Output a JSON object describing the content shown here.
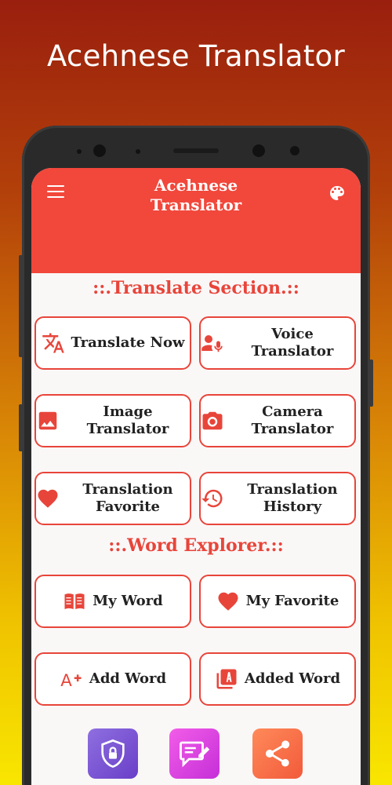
{
  "promo": {
    "title": "Acehnese Translator"
  },
  "appbar": {
    "title": "Acehnese\nTranslator"
  },
  "sections": {
    "translate": "::.Translate Section.::",
    "explorer": "::.Word Explorer.::"
  },
  "buttons": {
    "translate_now": "Translate Now",
    "voice_translator": "Voice Translator",
    "image_translator": "Image Translator",
    "camera_translator": "Camera Translator",
    "translation_favorite": "Translation Favorite",
    "translation_history": "Translation History",
    "my_word": "My Word",
    "my_favorite": "My Favorite",
    "add_word": "Add Word",
    "added_word": "Added Word"
  },
  "icons": {
    "translate": "translate-icon",
    "voice": "voice-icon",
    "image": "image-icon",
    "camera": "camera-icon",
    "favorite": "heart-icon",
    "history": "history-icon",
    "book": "book-icon",
    "add": "add-icon",
    "list": "list-icon",
    "privacy": "shield-icon",
    "feedback": "feedback-icon",
    "share": "share-icon"
  },
  "colors": {
    "accent": "#e8453a",
    "appbar": "#f2473b"
  }
}
